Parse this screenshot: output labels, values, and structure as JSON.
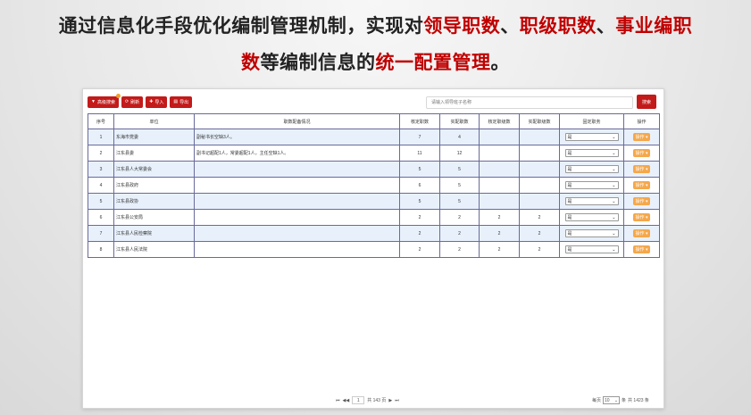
{
  "heading": {
    "line1_a": "通过信息化手段优化编制管理机制，实现对",
    "line1_hl1": "领导职数",
    "line1_sep1": "、",
    "line1_hl2": "职级职数",
    "line1_sep2": "、",
    "line1_hl3": "事业编职",
    "line2_hl4": "数",
    "line2_b": "等编制信息的",
    "line2_hl5": "统一配置管理",
    "line2_end": "。"
  },
  "toolbar": {
    "advanced_search": "高级搜索",
    "refresh": "刷新",
    "import": "导入",
    "export": "导出"
  },
  "search": {
    "placeholder": "请输入领导班子名称",
    "button": "搜索"
  },
  "table": {
    "headers": [
      "序号",
      "单位",
      "职数配备情况",
      "核定职数",
      "实配职数",
      "核定职级数",
      "实配职级数",
      "固定职务",
      "操作"
    ],
    "rows": [
      {
        "no": "1",
        "unit": "东海市党委",
        "note": "副秘书长空缺3人。",
        "c1": "7",
        "c2": "4",
        "c3": "",
        "c4": "",
        "fixed": "是",
        "op": "操作"
      },
      {
        "no": "2",
        "unit": "江东县委",
        "note": "副书记超配1人，常委超配1人，主任空缺1人。",
        "c1": "11",
        "c2": "12",
        "c3": "",
        "c4": "",
        "fixed": "是",
        "op": "操作"
      },
      {
        "no": "3",
        "unit": "江东县人大常委会",
        "note": "",
        "c1": "5",
        "c2": "5",
        "c3": "",
        "c4": "",
        "fixed": "是",
        "op": "操作"
      },
      {
        "no": "4",
        "unit": "江东县政府",
        "note": "",
        "c1": "6",
        "c2": "5",
        "c3": "",
        "c4": "",
        "fixed": "是",
        "op": "操作"
      },
      {
        "no": "5",
        "unit": "江东县政协",
        "note": "",
        "c1": "5",
        "c2": "5",
        "c3": "",
        "c4": "",
        "fixed": "是",
        "op": "操作"
      },
      {
        "no": "6",
        "unit": "江东县公安局",
        "note": "",
        "c1": "2",
        "c2": "2",
        "c3": "2",
        "c4": "2",
        "fixed": "是",
        "op": "操作"
      },
      {
        "no": "7",
        "unit": "江东县人民检察院",
        "note": "",
        "c1": "2",
        "c2": "2",
        "c3": "2",
        "c4": "2",
        "fixed": "是",
        "op": "操作"
      },
      {
        "no": "8",
        "unit": "江东县人民法院",
        "note": "",
        "c1": "2",
        "c2": "2",
        "c3": "2",
        "c4": "2",
        "fixed": "是",
        "op": "操作"
      }
    ]
  },
  "pagination": {
    "first": "⏮",
    "prev": "◀◀",
    "current_page": "1",
    "total_pages_text": "共 143 页",
    "next": "▶",
    "last": "⏭",
    "per_page_label": "每页",
    "per_page_value": "10",
    "per_page_unit": "条",
    "total_text": "共 1423 条"
  },
  "icons": {
    "filter": "filter-icon",
    "refresh": "refresh-icon",
    "import": "plus-icon",
    "export": "document-icon",
    "dropdown": "chevron-down-icon"
  },
  "colors": {
    "brand_red": "#c31a1a",
    "highlight_red": "#c00000",
    "op_orange": "#f5a74a",
    "row_alt_blue": "#e8f1fb",
    "grid_border": "#6a6a9a"
  }
}
